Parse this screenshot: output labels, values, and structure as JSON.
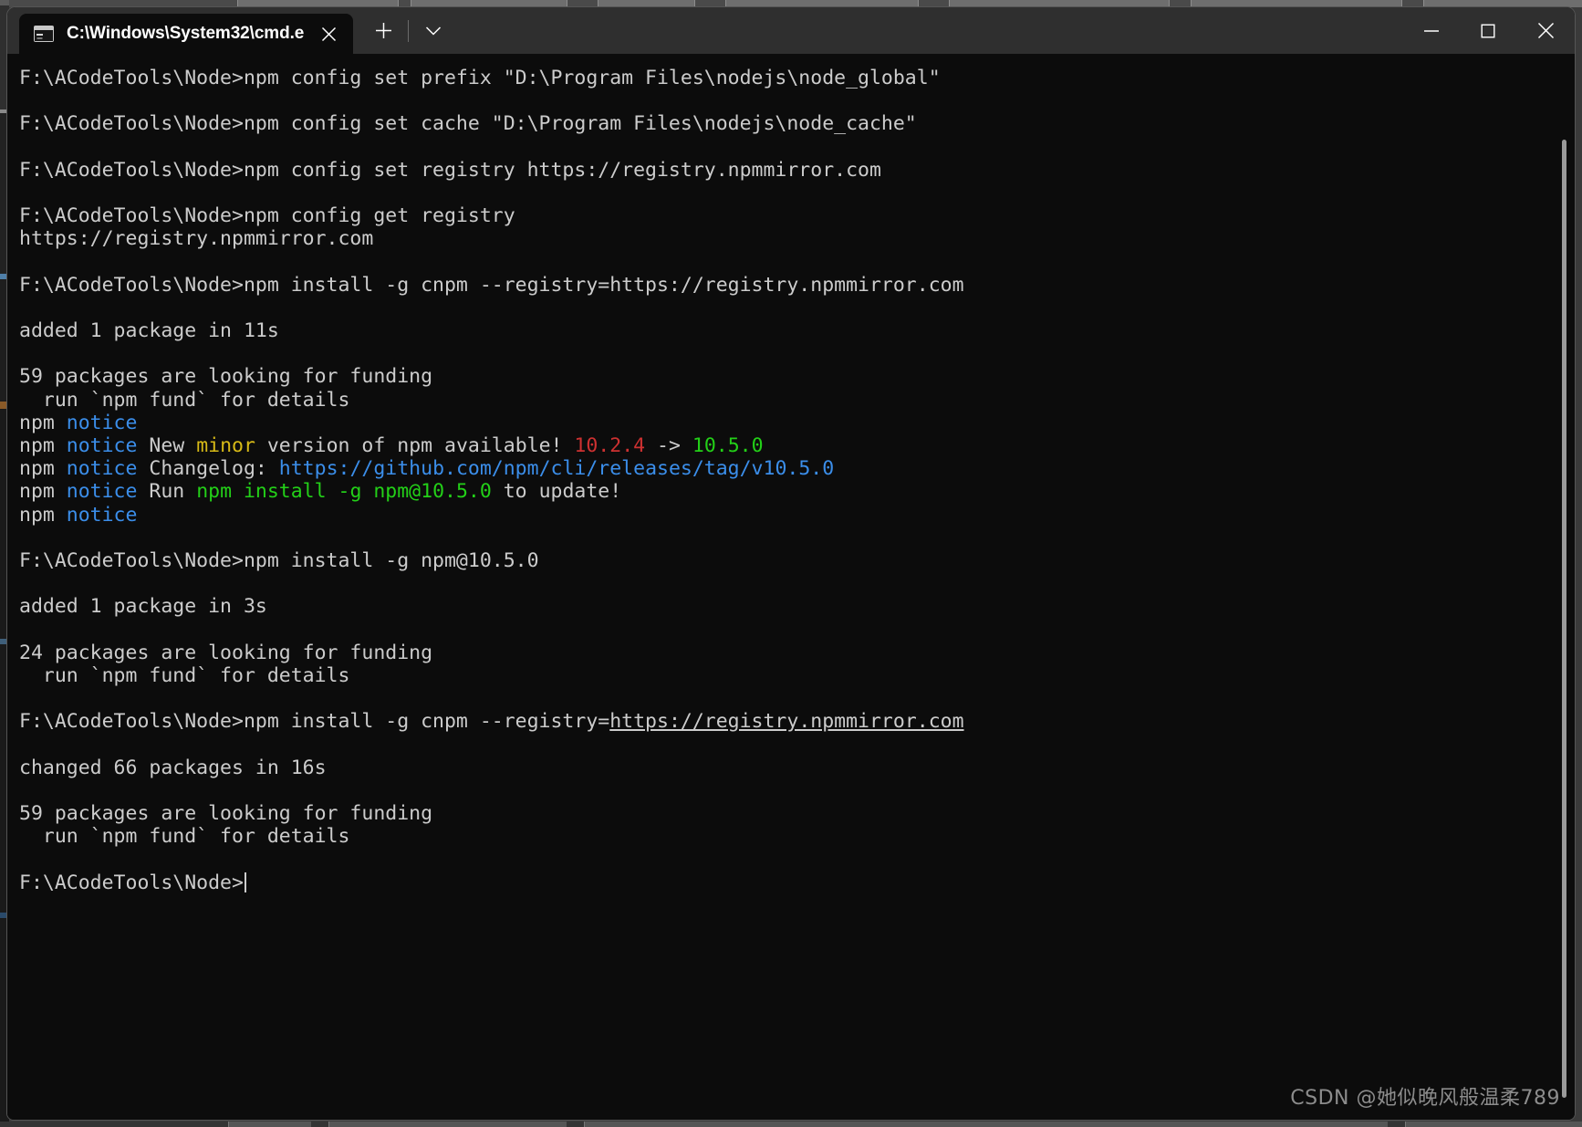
{
  "window": {
    "tab_title": "C:\\Windows\\System32\\cmd.e",
    "tab_icon": "cmd-console-icon",
    "close_tab_icon": "close-icon",
    "new_tab_icon": "plus-icon",
    "dropdown_icon": "chevron-down-icon",
    "minimize_icon": "minimize-icon",
    "maximize_icon": "maximize-icon",
    "close_icon": "close-icon"
  },
  "colors": {
    "background": "#0c0c0c",
    "titlebar": "#2f2f2f",
    "foreground": "#cccccc",
    "blue": "#3b8eea",
    "yellow": "#d7ba17",
    "red": "#cd3131",
    "green": "#23d018",
    "scrollbar": "#9a9a9a"
  },
  "terminal": {
    "prompt": "F:\\ACodeTools\\Node>",
    "lines": [
      {
        "id": "l01",
        "segments": [
          {
            "t": "F:\\ACodeTools\\Node>npm config set prefix \"D:\\Program Files\\nodejs\\node_global\"",
            "c": "white"
          }
        ]
      },
      {
        "id": "l02",
        "segments": []
      },
      {
        "id": "l03",
        "segments": [
          {
            "t": "F:\\ACodeTools\\Node>npm config set cache \"D:\\Program Files\\nodejs\\node_cache\"",
            "c": "white"
          }
        ]
      },
      {
        "id": "l04",
        "segments": []
      },
      {
        "id": "l05",
        "segments": [
          {
            "t": "F:\\ACodeTools\\Node>npm config set registry https://registry.npmmirror.com",
            "c": "white"
          }
        ]
      },
      {
        "id": "l06",
        "segments": []
      },
      {
        "id": "l07",
        "segments": [
          {
            "t": "F:\\ACodeTools\\Node>npm config get registry",
            "c": "white"
          }
        ]
      },
      {
        "id": "l08",
        "segments": [
          {
            "t": "https://registry.npmmirror.com",
            "c": "white"
          }
        ]
      },
      {
        "id": "l09",
        "segments": []
      },
      {
        "id": "l10",
        "segments": [
          {
            "t": "F:\\ACodeTools\\Node>npm install -g cnpm --registry=https://registry.npmmirror.com",
            "c": "white"
          }
        ]
      },
      {
        "id": "l11",
        "segments": []
      },
      {
        "id": "l12",
        "segments": [
          {
            "t": "added 1 package in 11s",
            "c": "white"
          }
        ]
      },
      {
        "id": "l13",
        "segments": []
      },
      {
        "id": "l14",
        "segments": [
          {
            "t": "59 packages are looking for funding",
            "c": "white"
          }
        ]
      },
      {
        "id": "l15",
        "segments": [
          {
            "t": "  run `npm fund` for details",
            "c": "white"
          }
        ]
      },
      {
        "id": "l16",
        "segments": [
          {
            "t": "npm ",
            "c": "white"
          },
          {
            "t": "notice",
            "c": "blue"
          }
        ]
      },
      {
        "id": "l17",
        "segments": [
          {
            "t": "npm ",
            "c": "white"
          },
          {
            "t": "notice",
            "c": "blue"
          },
          {
            "t": " New ",
            "c": "white"
          },
          {
            "t": "minor",
            "c": "yellow"
          },
          {
            "t": " version of npm available! ",
            "c": "white"
          },
          {
            "t": "10.2.4",
            "c": "red"
          },
          {
            "t": " -> ",
            "c": "white"
          },
          {
            "t": "10.5.0",
            "c": "green"
          }
        ]
      },
      {
        "id": "l18",
        "segments": [
          {
            "t": "npm ",
            "c": "white"
          },
          {
            "t": "notice",
            "c": "blue"
          },
          {
            "t": " Changelog: ",
            "c": "white"
          },
          {
            "t": "https://github.com/npm/cli/releases/tag/v10.5.0",
            "c": "link"
          }
        ]
      },
      {
        "id": "l19",
        "segments": [
          {
            "t": "npm ",
            "c": "white"
          },
          {
            "t": "notice",
            "c": "blue"
          },
          {
            "t": " Run ",
            "c": "white"
          },
          {
            "t": "npm install -g npm@10.5.0",
            "c": "green"
          },
          {
            "t": " to update!",
            "c": "white"
          }
        ]
      },
      {
        "id": "l20",
        "segments": [
          {
            "t": "npm ",
            "c": "white"
          },
          {
            "t": "notice",
            "c": "blue"
          }
        ]
      },
      {
        "id": "l21",
        "segments": []
      },
      {
        "id": "l22",
        "segments": [
          {
            "t": "F:\\ACodeTools\\Node>npm install -g npm@10.5.0",
            "c": "white"
          }
        ]
      },
      {
        "id": "l23",
        "segments": []
      },
      {
        "id": "l24",
        "segments": [
          {
            "t": "added 1 package in 3s",
            "c": "white"
          }
        ]
      },
      {
        "id": "l25",
        "segments": []
      },
      {
        "id": "l26",
        "segments": [
          {
            "t": "24 packages are looking for funding",
            "c": "white"
          }
        ]
      },
      {
        "id": "l27",
        "segments": [
          {
            "t": "  run `npm fund` for details",
            "c": "white"
          }
        ]
      },
      {
        "id": "l28",
        "segments": []
      },
      {
        "id": "l29",
        "segments": [
          {
            "t": "F:\\ACodeTools\\Node>npm install -g cnpm --registry=",
            "c": "white"
          },
          {
            "t": "https://registry.npmmirror.com",
            "c": "white",
            "underline": true
          }
        ]
      },
      {
        "id": "l30",
        "segments": []
      },
      {
        "id": "l31",
        "segments": [
          {
            "t": "changed 66 packages in 16s",
            "c": "white"
          }
        ]
      },
      {
        "id": "l32",
        "segments": []
      },
      {
        "id": "l33",
        "segments": [
          {
            "t": "59 packages are looking for funding",
            "c": "white"
          }
        ]
      },
      {
        "id": "l34",
        "segments": [
          {
            "t": "  run `npm fund` for details",
            "c": "white"
          }
        ]
      },
      {
        "id": "l35",
        "segments": []
      },
      {
        "id": "l36",
        "segments": [
          {
            "t": "F:\\ACodeTools\\Node>",
            "c": "white"
          }
        ],
        "cursor": true
      }
    ]
  },
  "watermark": {
    "text": "CSDN @她似晚风般温柔789"
  }
}
